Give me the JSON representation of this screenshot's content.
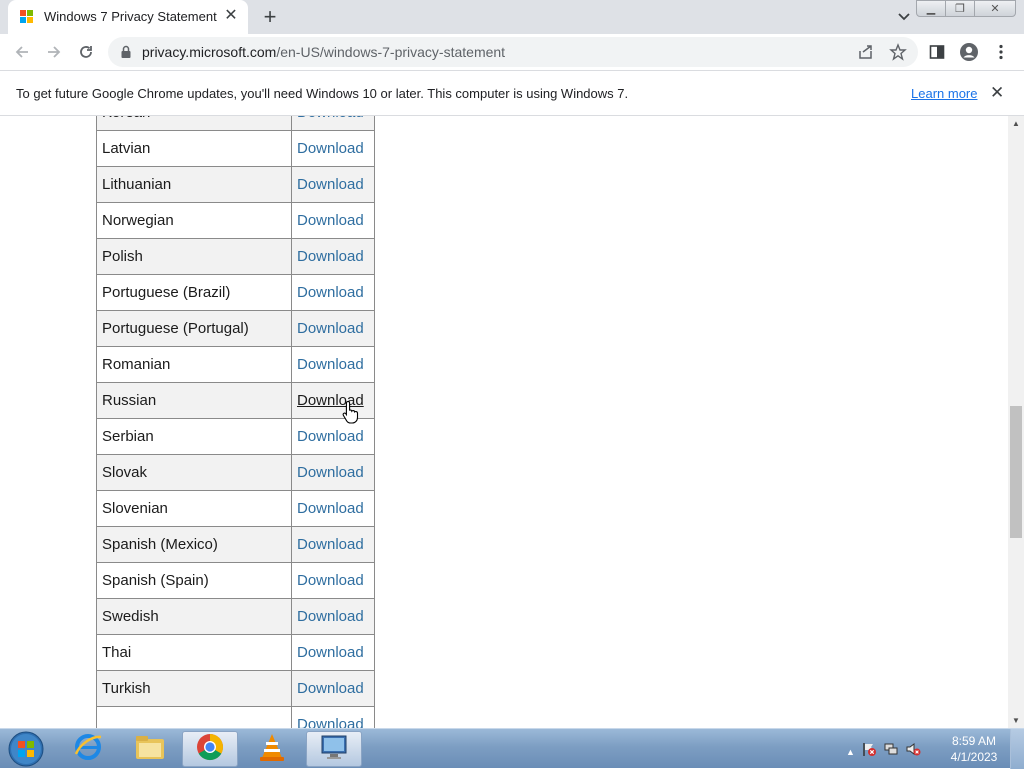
{
  "browser": {
    "tab_title": "Windows 7 Privacy Statement",
    "url_domain": "privacy.microsoft.com",
    "url_path": "/en-US/windows-7-privacy-statement"
  },
  "infobar": {
    "message": "To get future Google Chrome updates, you'll need Windows 10 or later. This computer is using Windows 7.",
    "link": "Learn more"
  },
  "table": {
    "rows": [
      {
        "language": "Korean",
        "link": "Download"
      },
      {
        "language": "Latvian",
        "link": "Download"
      },
      {
        "language": "Lithuanian",
        "link": "Download"
      },
      {
        "language": "Norwegian",
        "link": "Download"
      },
      {
        "language": "Polish",
        "link": "Download"
      },
      {
        "language": "Portuguese (Brazil)",
        "link": "Download"
      },
      {
        "language": "Portuguese (Portugal)",
        "link": "Download"
      },
      {
        "language": "Romanian",
        "link": "Download"
      },
      {
        "language": "Russian",
        "link": "Download"
      },
      {
        "language": "Serbian",
        "link": "Download"
      },
      {
        "language": "Slovak",
        "link": "Download"
      },
      {
        "language": "Slovenian",
        "link": "Download"
      },
      {
        "language": "Spanish (Mexico)",
        "link": "Download"
      },
      {
        "language": "Spanish (Spain)",
        "link": "Download"
      },
      {
        "language": "Swedish",
        "link": "Download"
      },
      {
        "language": "Thai",
        "link": "Download"
      },
      {
        "language": "Turkish",
        "link": "Download"
      },
      {
        "language": "",
        "link": "Download"
      }
    ],
    "hovered_row": 8
  },
  "taskbar": {
    "apps": [
      "internet-explorer-icon",
      "file-explorer-icon",
      "chrome-icon",
      "vlc-icon",
      "remote-desktop-icon"
    ],
    "time": "8:59 AM",
    "date": "4/1/2023"
  },
  "colors": {
    "link": "#2f6ea0",
    "row_alt": "#f2f2f2",
    "border": "#8a8a8a",
    "chrome_frame": "#dee1e6"
  }
}
